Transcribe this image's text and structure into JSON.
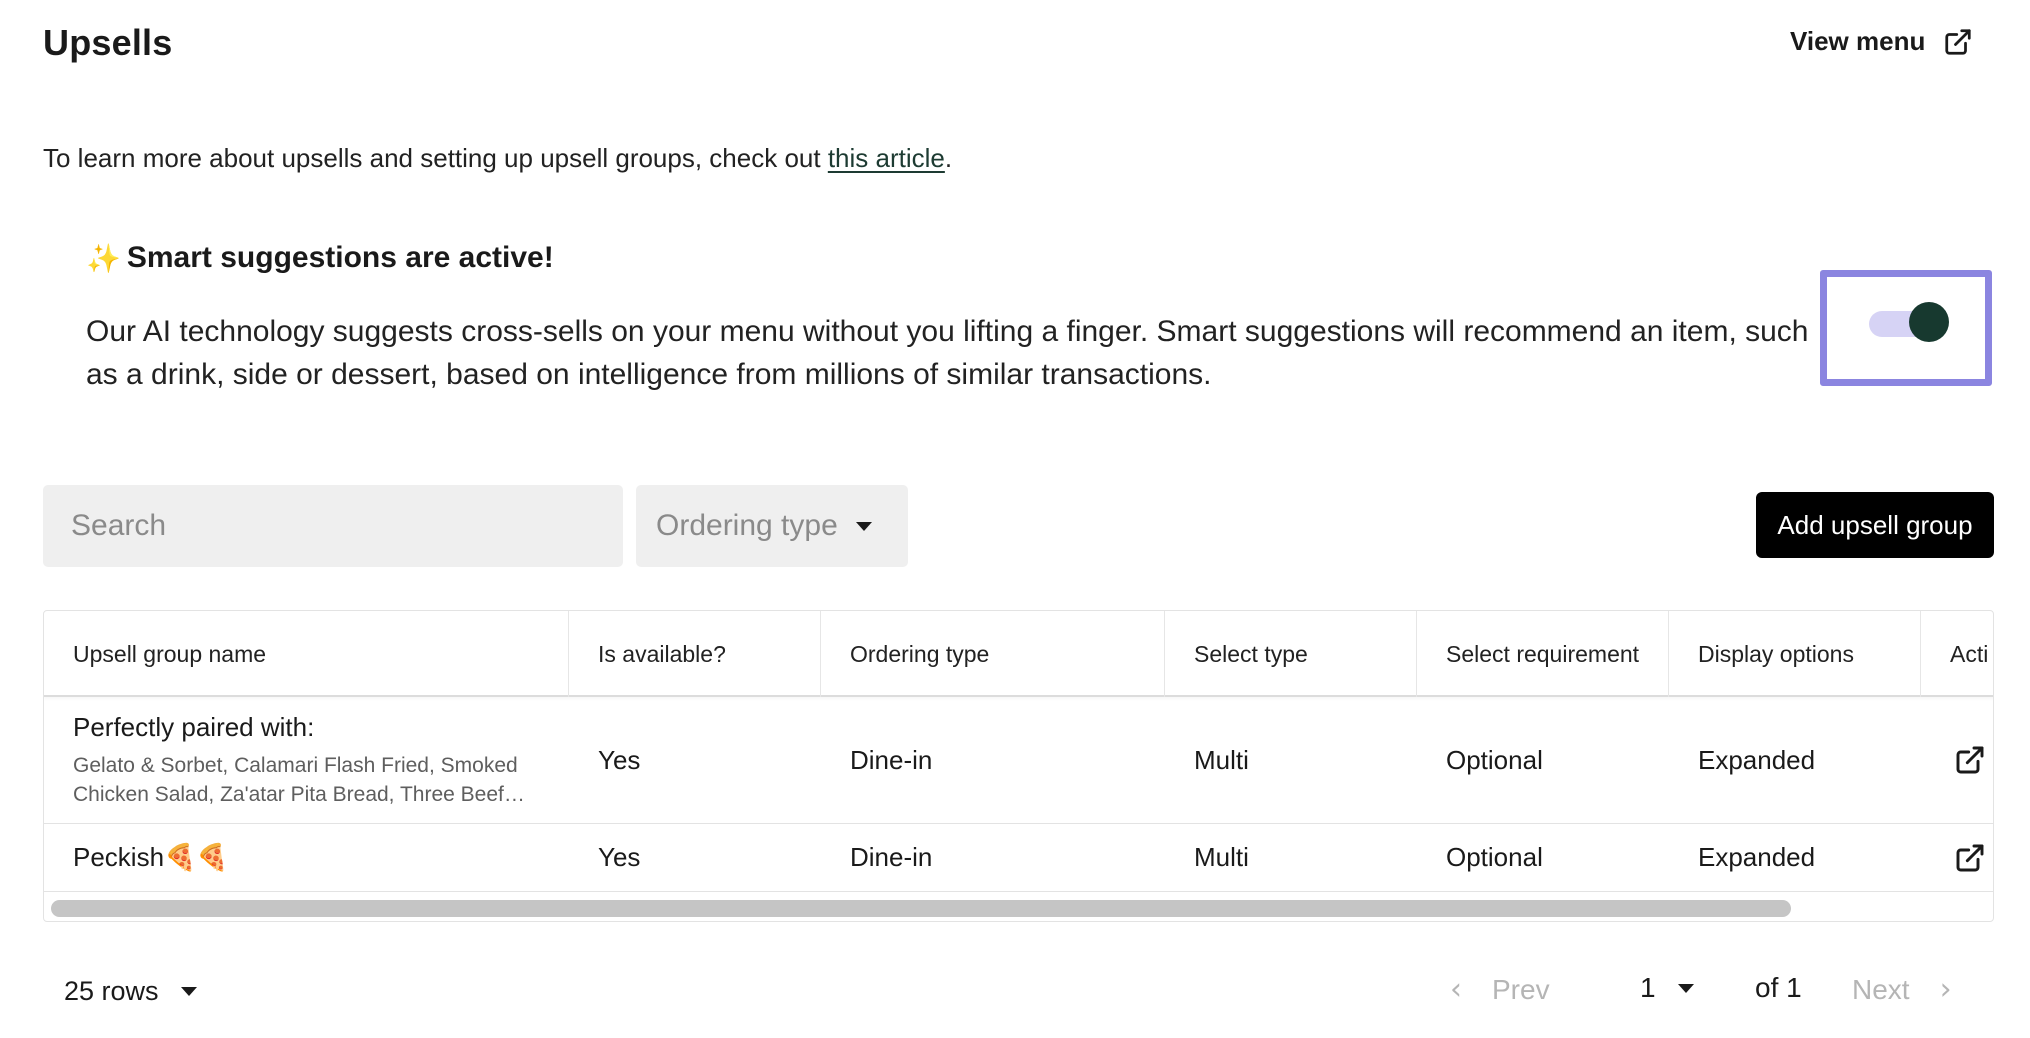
{
  "header": {
    "title": "Upsells",
    "view_menu_label": "View menu"
  },
  "intro": {
    "text_before": "To learn more about upsells and setting up upsell groups, check out ",
    "link_text": "this article",
    "text_after": "."
  },
  "smart_suggestions": {
    "icon": "sparkles-icon",
    "title": "Smart suggestions are active!",
    "description": "Our AI technology suggests cross-sells on your menu without you lifting a finger. Smart suggestions will recommend an item, such as a drink, side or dessert, based on intelligence from millions of similar transactions.",
    "toggle_on": true
  },
  "filters": {
    "search_placeholder": "Search",
    "ordering_type_placeholder": "Ordering type"
  },
  "actions": {
    "add_label": "Add upsell group"
  },
  "table": {
    "columns": [
      "Upsell group name",
      "Is available?",
      "Ordering type",
      "Select type",
      "Select requirement",
      "Display options",
      "Acti"
    ],
    "rows": [
      {
        "name": "Perfectly paired with:",
        "items": "Gelato & Sorbet, Calamari Flash Fried, Smoked Chicken Salad, Za'atar Pita Bread, Three Beef…",
        "available": "Yes",
        "ordering_type": "Dine-in",
        "select_type": "Multi",
        "select_requirement": "Optional",
        "display_options": "Expanded"
      },
      {
        "name": "Peckish🍕🍕",
        "items": "",
        "available": "Yes",
        "ordering_type": "Dine-in",
        "select_type": "Multi",
        "select_requirement": "Optional",
        "display_options": "Expanded"
      }
    ]
  },
  "pagination": {
    "rows_label": "25 rows",
    "prev_label": "Prev",
    "current_page": "1",
    "of_label": "of 1",
    "next_label": "Next"
  },
  "colors": {
    "accent_frame": "#8b85e0",
    "toggle_knob": "#17392f",
    "toggle_track": "#d6d3f5",
    "primary_button": "#000000"
  }
}
